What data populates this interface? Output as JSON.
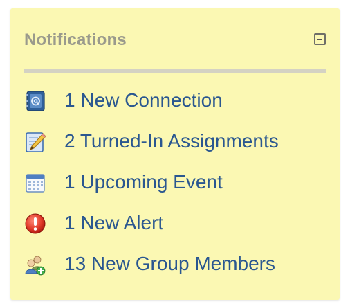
{
  "panel": {
    "title": "Notifications",
    "collapse_icon": "collapse-minus-icon"
  },
  "notifications": [
    {
      "label": "1 New Connection",
      "icon": "address-book-icon"
    },
    {
      "label": "2 Turned-In Assignments",
      "icon": "pencil-document-icon"
    },
    {
      "label": "1 Upcoming Event",
      "icon": "calendar-icon"
    },
    {
      "label": "1 New Alert",
      "icon": "alert-icon"
    },
    {
      "label": "13 New Group Members",
      "icon": "add-group-icon"
    }
  ],
  "colors": {
    "panel_background": "#fbf8b3",
    "title": "#9a9a8c",
    "link": "#2a5790",
    "divider": "#d4d2c3",
    "alert_red": "#d93a2b"
  }
}
